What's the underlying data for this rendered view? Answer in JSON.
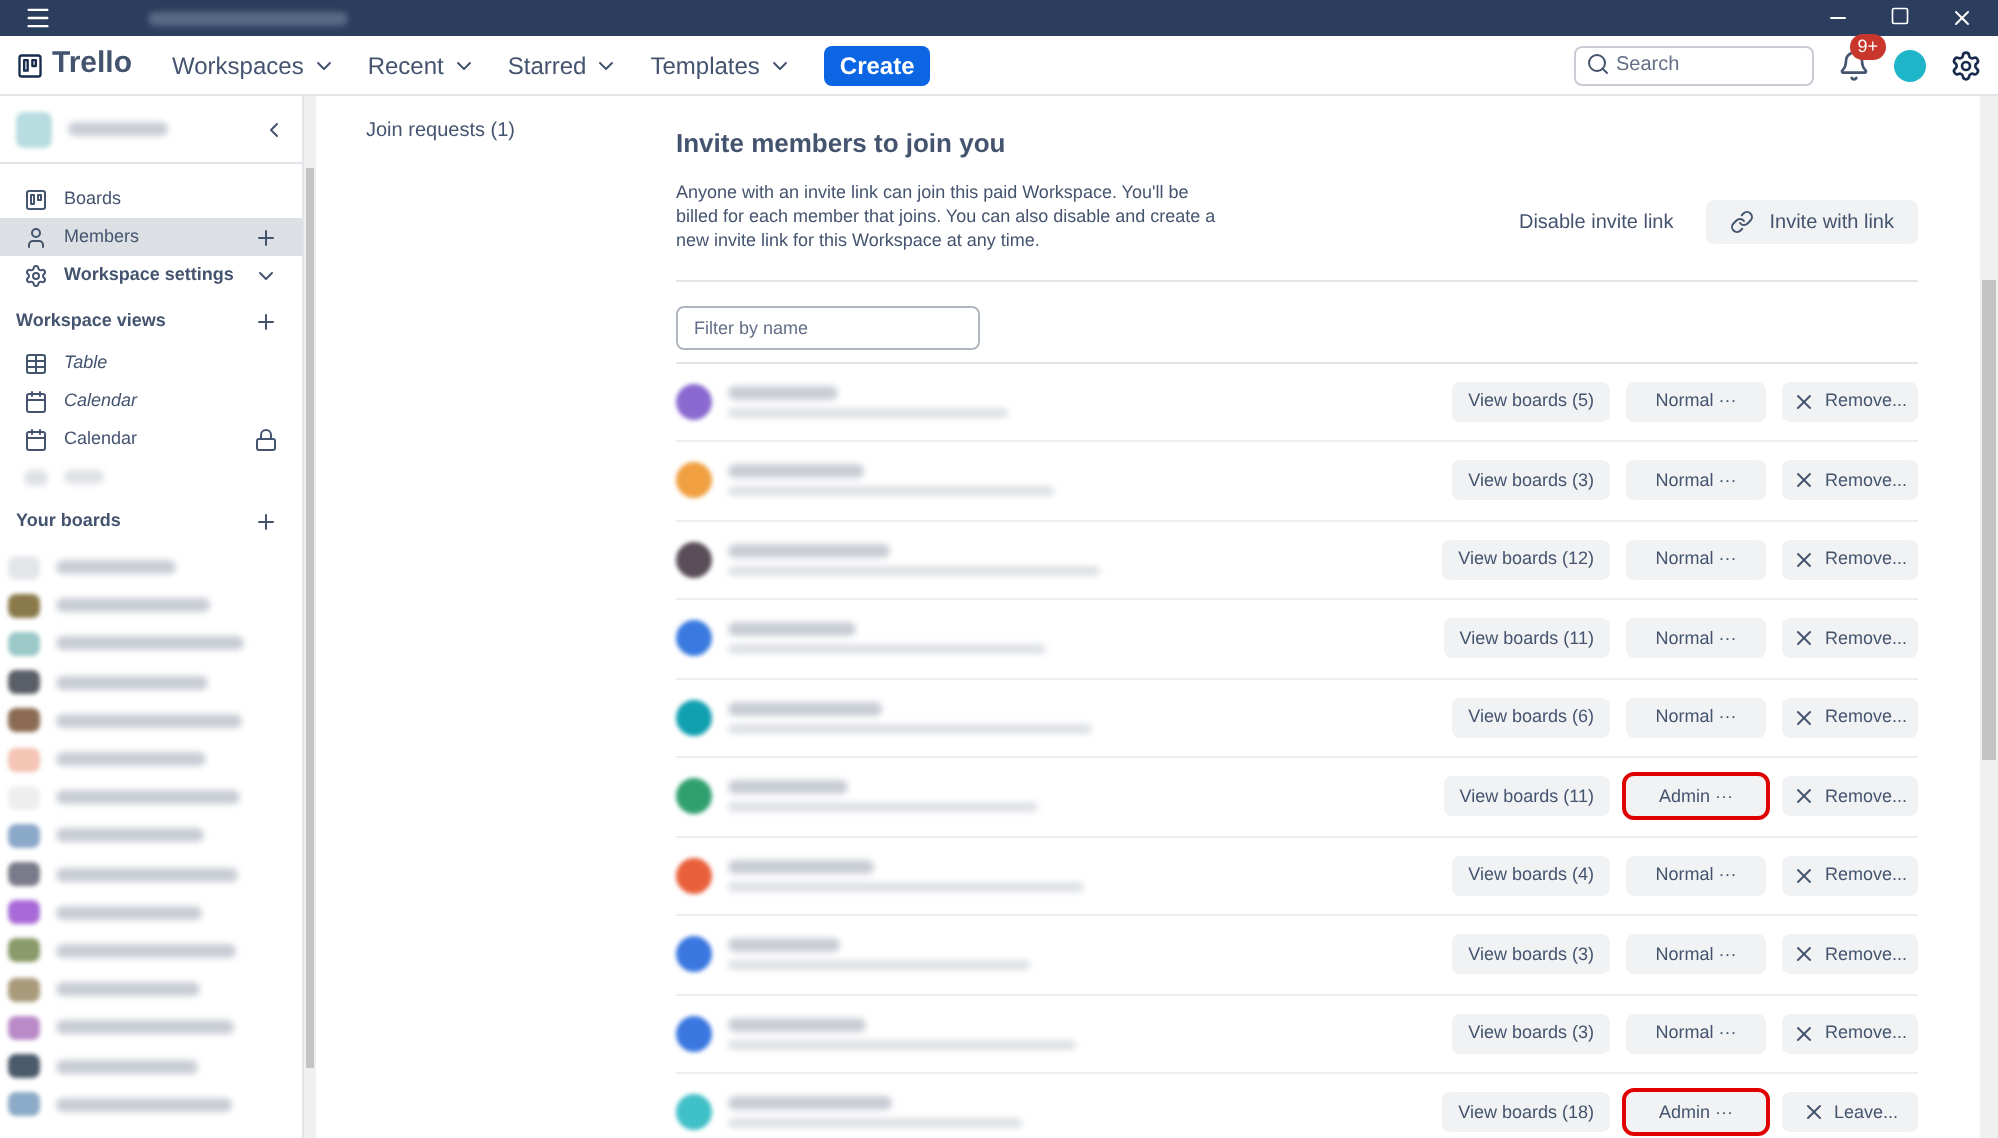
{
  "nav": {
    "logo": "Trello",
    "menus": [
      "Workspaces",
      "Recent",
      "Starred",
      "Templates"
    ],
    "create": "Create",
    "search": {
      "placeholder": "Search"
    },
    "notification_badge": "9+"
  },
  "sidebar": {
    "items": [
      {
        "label": "Boards",
        "kind": "boards",
        "selected": false
      },
      {
        "label": "Members",
        "kind": "members",
        "selected": true
      },
      {
        "label": "Workspace settings",
        "kind": "settings",
        "selected": false
      }
    ],
    "views_heading": "Workspace views",
    "views": [
      {
        "label": "Table",
        "kind": "table",
        "italic": true,
        "locked": false
      },
      {
        "label": "Calendar",
        "kind": "calendar",
        "italic": true,
        "locked": false
      },
      {
        "label": "Calendar",
        "kind": "calendar",
        "italic": false,
        "locked": true
      }
    ],
    "boards_heading": "Your boards",
    "boards": [
      {
        "color": "#e4e6ea"
      },
      {
        "color": "#8a7a4a"
      },
      {
        "color": "#9cc8c8"
      },
      {
        "color": "#5a5e66"
      },
      {
        "color": "#8a6a52"
      },
      {
        "color": "#f4c4b4"
      },
      {
        "color": "#eeeeee"
      },
      {
        "color": "#8aa8c8"
      },
      {
        "color": "#7a7a8a"
      },
      {
        "color": "#a86ad8"
      },
      {
        "color": "#8a9a6a"
      },
      {
        "color": "#a89a7a"
      },
      {
        "color": "#b88ac8"
      },
      {
        "color": "#4a5a6a"
      },
      {
        "color": "#8aaac8"
      }
    ]
  },
  "join_requests": "Join requests (1)",
  "invite": {
    "title": "Invite members to join you",
    "description": "Anyone with an invite link can join this paid Workspace. You'll be billed for each member that joins. You can also disable and create a new invite link for this Workspace at any time.",
    "disable": "Disable invite link",
    "invite_button": "Invite with link"
  },
  "filter": {
    "placeholder": "Filter by name"
  },
  "members": [
    {
      "color": "#8a6ad0",
      "boards": "View boards (5)",
      "role": "Normal ···",
      "highlighted": false,
      "action": "Remove..."
    },
    {
      "color": "#f0a040",
      "boards": "View boards (3)",
      "role": "Normal ···",
      "highlighted": false,
      "action": "Remove..."
    },
    {
      "color": "#5a4e58",
      "boards": "View boards (12)",
      "role": "Normal ···",
      "highlighted": false,
      "action": "Remove..."
    },
    {
      "color": "#3a7ae0",
      "boards": "View boards (11)",
      "role": "Normal ···",
      "highlighted": false,
      "action": "Remove..."
    },
    {
      "color": "#10a0b0",
      "boards": "View boards (6)",
      "role": "Normal ···",
      "highlighted": false,
      "action": "Remove..."
    },
    {
      "color": "#30a070",
      "boards": "View boards (11)",
      "role": "Admin ···",
      "highlighted": true,
      "action": "Remove..."
    },
    {
      "color": "#e8603a",
      "boards": "View boards (4)",
      "role": "Normal ···",
      "highlighted": false,
      "action": "Remove..."
    },
    {
      "color": "#3a78e0",
      "boards": "View boards (3)",
      "role": "Normal ···",
      "highlighted": false,
      "action": "Remove..."
    },
    {
      "color": "#3a78e0",
      "boards": "View boards (3)",
      "role": "Normal ···",
      "highlighted": false,
      "action": "Remove..."
    },
    {
      "color": "#40c0c8",
      "boards": "View boards (18)",
      "role": "Admin ···",
      "highlighted": true,
      "action": "Leave..."
    }
  ]
}
